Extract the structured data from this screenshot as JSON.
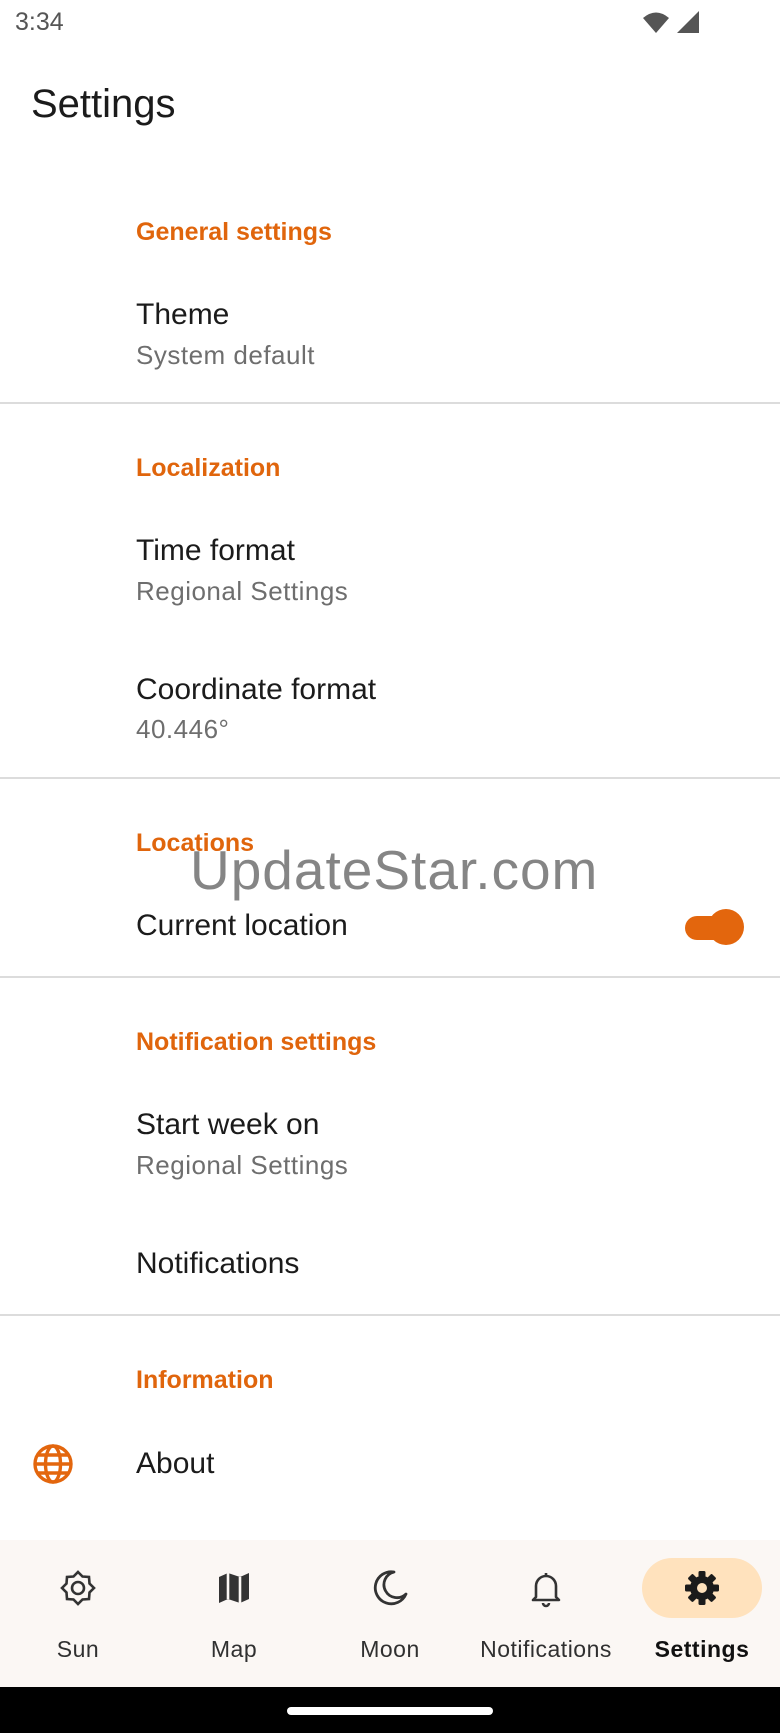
{
  "status_bar": {
    "time": "3:34"
  },
  "page": {
    "title": "Settings"
  },
  "sections": {
    "general": {
      "header": "General settings",
      "theme_title": "Theme",
      "theme_value": "System default"
    },
    "localization": {
      "header": "Localization",
      "time_format_title": "Time format",
      "time_format_value": "Regional Settings",
      "coord_format_title": "Coordinate format",
      "coord_format_value": "40.446°"
    },
    "locations": {
      "header": "Locations",
      "current_location_title": "Current location",
      "current_location_enabled": true
    },
    "notification_settings": {
      "header": "Notification settings",
      "start_week_title": "Start week on",
      "start_week_value": "Regional Settings",
      "notifications_title": "Notifications"
    },
    "information": {
      "header": "Information",
      "about_title": "About",
      "about_icon": "globe-icon"
    }
  },
  "watermark": "UpdateStar.com",
  "bottom_nav": {
    "items": [
      {
        "label": "Sun",
        "icon": "sun-icon"
      },
      {
        "label": "Map",
        "icon": "map-icon"
      },
      {
        "label": "Moon",
        "icon": "moon-icon"
      },
      {
        "label": "Notifications",
        "icon": "bell-icon"
      },
      {
        "label": "Settings",
        "icon": "gear-icon",
        "active": true
      }
    ]
  },
  "colors": {
    "accent": "#e3660d",
    "active_pill": "#ffe2bd"
  }
}
